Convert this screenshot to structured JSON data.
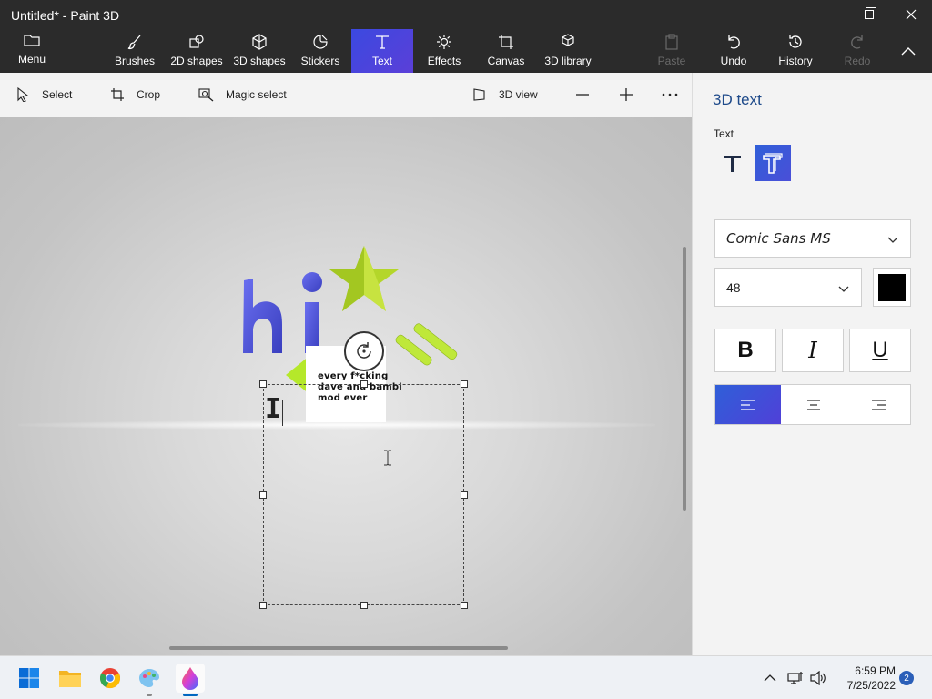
{
  "window": {
    "title": "Untitled* - Paint 3D"
  },
  "ribbon": {
    "menu_label": "Menu",
    "tools": [
      {
        "label": "Brushes",
        "icon": "brush-icon"
      },
      {
        "label": "2D shapes",
        "icon": "2d-shapes-icon"
      },
      {
        "label": "3D shapes",
        "icon": "3d-shapes-icon"
      },
      {
        "label": "Stickers",
        "icon": "stickers-icon"
      },
      {
        "label": "Text",
        "icon": "text-icon",
        "active": true
      },
      {
        "label": "Effects",
        "icon": "effects-icon"
      },
      {
        "label": "Canvas",
        "icon": "canvas-icon"
      },
      {
        "label": "3D library",
        "icon": "3d-library-icon"
      }
    ],
    "actions": [
      {
        "label": "Paste",
        "icon": "paste-icon",
        "disabled": true
      },
      {
        "label": "Undo",
        "icon": "undo-icon"
      },
      {
        "label": "History",
        "icon": "history-icon"
      },
      {
        "label": "Redo",
        "icon": "redo-icon",
        "disabled": true
      }
    ]
  },
  "toolbar": {
    "select_label": "Select",
    "crop_label": "Crop",
    "magic_select_label": "Magic select",
    "view3d_label": "3D view"
  },
  "canvas": {
    "card_text": "every f*cking dave and bambi mod ever",
    "text_caret_glyph": "I"
  },
  "panel": {
    "title": "3D text",
    "text_section_label": "Text",
    "font_family_value": "Comic Sans MS",
    "font_size_value": "48",
    "text_color": "#000000",
    "bold_label": "B",
    "italic_label": "I",
    "underline_label": "U",
    "accent_color": "#3056d8"
  },
  "taskbar": {
    "apps": [
      "start-icon",
      "file-explorer-icon",
      "chrome-icon",
      "paint-icon",
      "paint-3d-icon"
    ],
    "time": "6:59 PM",
    "date": "7/25/2022",
    "notification_count": "2"
  }
}
